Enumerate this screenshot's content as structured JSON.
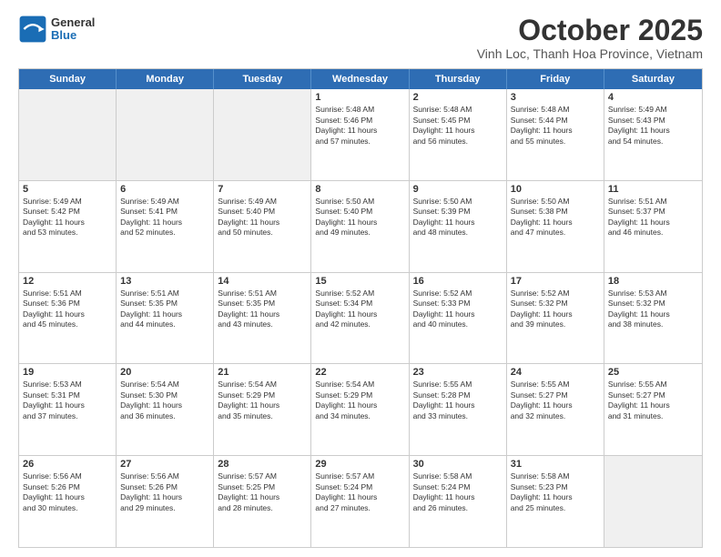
{
  "header": {
    "logo": {
      "general": "General",
      "blue": "Blue"
    },
    "title": "October 2025",
    "location": "Vinh Loc, Thanh Hoa Province, Vietnam"
  },
  "days_of_week": [
    "Sunday",
    "Monday",
    "Tuesday",
    "Wednesday",
    "Thursday",
    "Friday",
    "Saturday"
  ],
  "weeks": [
    [
      {
        "day": "",
        "info": ""
      },
      {
        "day": "",
        "info": ""
      },
      {
        "day": "",
        "info": ""
      },
      {
        "day": "1",
        "info": "Sunrise: 5:48 AM\nSunset: 5:46 PM\nDaylight: 11 hours\nand 57 minutes."
      },
      {
        "day": "2",
        "info": "Sunrise: 5:48 AM\nSunset: 5:45 PM\nDaylight: 11 hours\nand 56 minutes."
      },
      {
        "day": "3",
        "info": "Sunrise: 5:48 AM\nSunset: 5:44 PM\nDaylight: 11 hours\nand 55 minutes."
      },
      {
        "day": "4",
        "info": "Sunrise: 5:49 AM\nSunset: 5:43 PM\nDaylight: 11 hours\nand 54 minutes."
      }
    ],
    [
      {
        "day": "5",
        "info": "Sunrise: 5:49 AM\nSunset: 5:42 PM\nDaylight: 11 hours\nand 53 minutes."
      },
      {
        "day": "6",
        "info": "Sunrise: 5:49 AM\nSunset: 5:41 PM\nDaylight: 11 hours\nand 52 minutes."
      },
      {
        "day": "7",
        "info": "Sunrise: 5:49 AM\nSunset: 5:40 PM\nDaylight: 11 hours\nand 50 minutes."
      },
      {
        "day": "8",
        "info": "Sunrise: 5:50 AM\nSunset: 5:40 PM\nDaylight: 11 hours\nand 49 minutes."
      },
      {
        "day": "9",
        "info": "Sunrise: 5:50 AM\nSunset: 5:39 PM\nDaylight: 11 hours\nand 48 minutes."
      },
      {
        "day": "10",
        "info": "Sunrise: 5:50 AM\nSunset: 5:38 PM\nDaylight: 11 hours\nand 47 minutes."
      },
      {
        "day": "11",
        "info": "Sunrise: 5:51 AM\nSunset: 5:37 PM\nDaylight: 11 hours\nand 46 minutes."
      }
    ],
    [
      {
        "day": "12",
        "info": "Sunrise: 5:51 AM\nSunset: 5:36 PM\nDaylight: 11 hours\nand 45 minutes."
      },
      {
        "day": "13",
        "info": "Sunrise: 5:51 AM\nSunset: 5:35 PM\nDaylight: 11 hours\nand 44 minutes."
      },
      {
        "day": "14",
        "info": "Sunrise: 5:51 AM\nSunset: 5:35 PM\nDaylight: 11 hours\nand 43 minutes."
      },
      {
        "day": "15",
        "info": "Sunrise: 5:52 AM\nSunset: 5:34 PM\nDaylight: 11 hours\nand 42 minutes."
      },
      {
        "day": "16",
        "info": "Sunrise: 5:52 AM\nSunset: 5:33 PM\nDaylight: 11 hours\nand 40 minutes."
      },
      {
        "day": "17",
        "info": "Sunrise: 5:52 AM\nSunset: 5:32 PM\nDaylight: 11 hours\nand 39 minutes."
      },
      {
        "day": "18",
        "info": "Sunrise: 5:53 AM\nSunset: 5:32 PM\nDaylight: 11 hours\nand 38 minutes."
      }
    ],
    [
      {
        "day": "19",
        "info": "Sunrise: 5:53 AM\nSunset: 5:31 PM\nDaylight: 11 hours\nand 37 minutes."
      },
      {
        "day": "20",
        "info": "Sunrise: 5:54 AM\nSunset: 5:30 PM\nDaylight: 11 hours\nand 36 minutes."
      },
      {
        "day": "21",
        "info": "Sunrise: 5:54 AM\nSunset: 5:29 PM\nDaylight: 11 hours\nand 35 minutes."
      },
      {
        "day": "22",
        "info": "Sunrise: 5:54 AM\nSunset: 5:29 PM\nDaylight: 11 hours\nand 34 minutes."
      },
      {
        "day": "23",
        "info": "Sunrise: 5:55 AM\nSunset: 5:28 PM\nDaylight: 11 hours\nand 33 minutes."
      },
      {
        "day": "24",
        "info": "Sunrise: 5:55 AM\nSunset: 5:27 PM\nDaylight: 11 hours\nand 32 minutes."
      },
      {
        "day": "25",
        "info": "Sunrise: 5:55 AM\nSunset: 5:27 PM\nDaylight: 11 hours\nand 31 minutes."
      }
    ],
    [
      {
        "day": "26",
        "info": "Sunrise: 5:56 AM\nSunset: 5:26 PM\nDaylight: 11 hours\nand 30 minutes."
      },
      {
        "day": "27",
        "info": "Sunrise: 5:56 AM\nSunset: 5:26 PM\nDaylight: 11 hours\nand 29 minutes."
      },
      {
        "day": "28",
        "info": "Sunrise: 5:57 AM\nSunset: 5:25 PM\nDaylight: 11 hours\nand 28 minutes."
      },
      {
        "day": "29",
        "info": "Sunrise: 5:57 AM\nSunset: 5:24 PM\nDaylight: 11 hours\nand 27 minutes."
      },
      {
        "day": "30",
        "info": "Sunrise: 5:58 AM\nSunset: 5:24 PM\nDaylight: 11 hours\nand 26 minutes."
      },
      {
        "day": "31",
        "info": "Sunrise: 5:58 AM\nSunset: 5:23 PM\nDaylight: 11 hours\nand 25 minutes."
      },
      {
        "day": "",
        "info": ""
      }
    ]
  ]
}
